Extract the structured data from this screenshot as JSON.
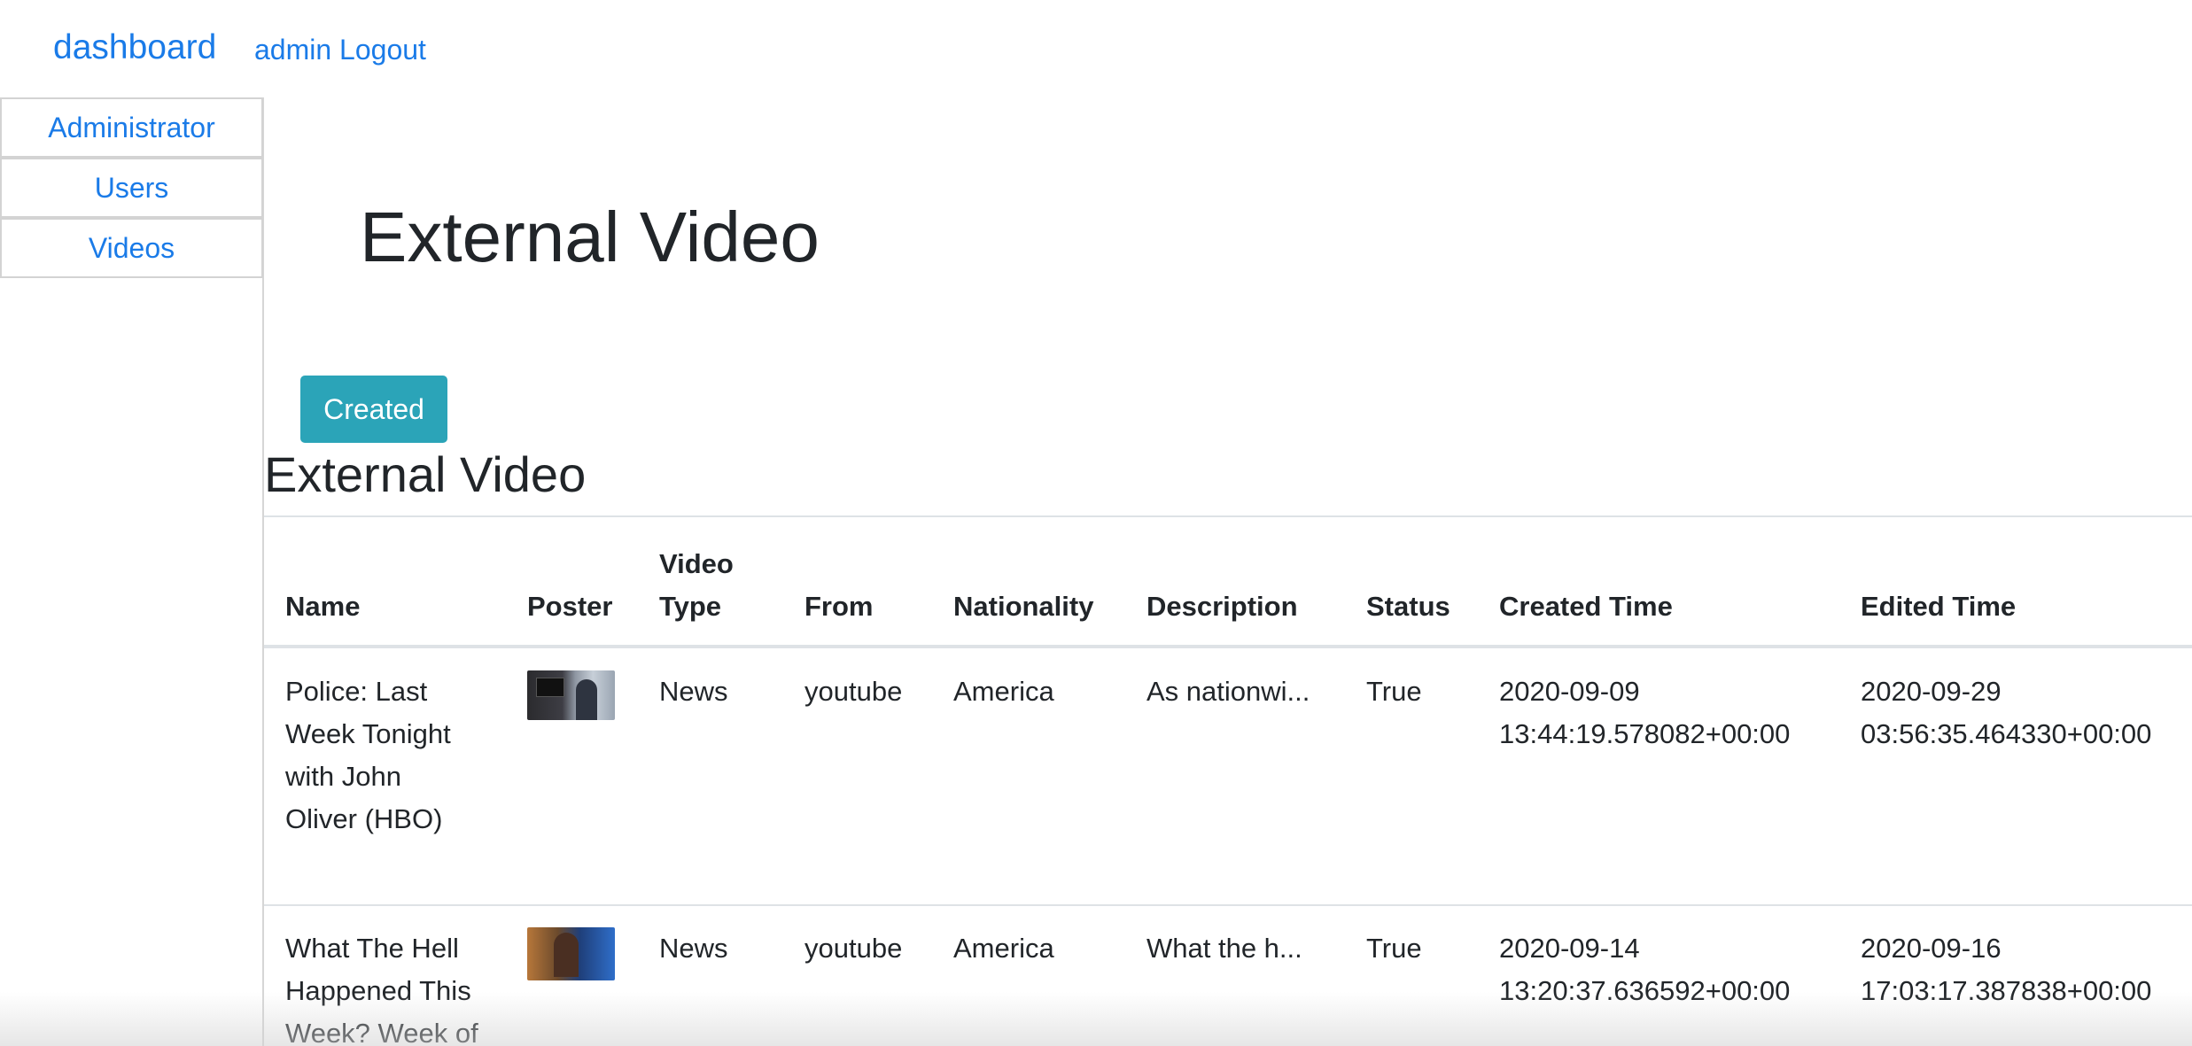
{
  "nav": {
    "brand": "dashboard",
    "user_logout": "admin Logout"
  },
  "sidebar": {
    "items": [
      {
        "label": "Administrator"
      },
      {
        "label": "Users"
      },
      {
        "label": "Videos"
      }
    ]
  },
  "main": {
    "page_title": "External Video",
    "create_button": "Created",
    "section_title": "External Video"
  },
  "table": {
    "headers": {
      "name": "Name",
      "poster": "Poster",
      "video_type_1": "Video",
      "video_type_2": "Type",
      "from": "From",
      "nationality": "Nationality",
      "description": "Description",
      "status": "Status",
      "created_time": "Created Time",
      "edited_time": "Edited Time"
    },
    "rows": [
      {
        "name_lines": [
          "Police: Last",
          "Week Tonight",
          "with John",
          "Oliver (HBO)"
        ],
        "video_type": "News",
        "from": "youtube",
        "nationality": "America",
        "description": "As nationwi...",
        "status": "True",
        "created_date": "2020-09-09",
        "created_clock": "13:44:19.578082+00:00",
        "edited_date": "2020-09-29",
        "edited_clock": "03:56:35.464330+00:00"
      },
      {
        "name_lines": [
          "What The Hell",
          "Happened This",
          "Week? Week of"
        ],
        "video_type": "News",
        "from": "youtube",
        "nationality": "America",
        "description": "What the h...",
        "status": "True",
        "created_date": "2020-09-14",
        "created_clock": "13:20:37.636592+00:00",
        "edited_date": "2020-09-16",
        "edited_clock": "17:03:17.387838+00:00"
      }
    ]
  },
  "colors": {
    "link": "#1a7be8",
    "button": "#2ba4b8",
    "text": "#212529",
    "border": "#dee2e6"
  },
  "icons": {
    "poster_row_1": "video-thumbnail-image",
    "poster_row_2": "video-thumbnail-image"
  }
}
